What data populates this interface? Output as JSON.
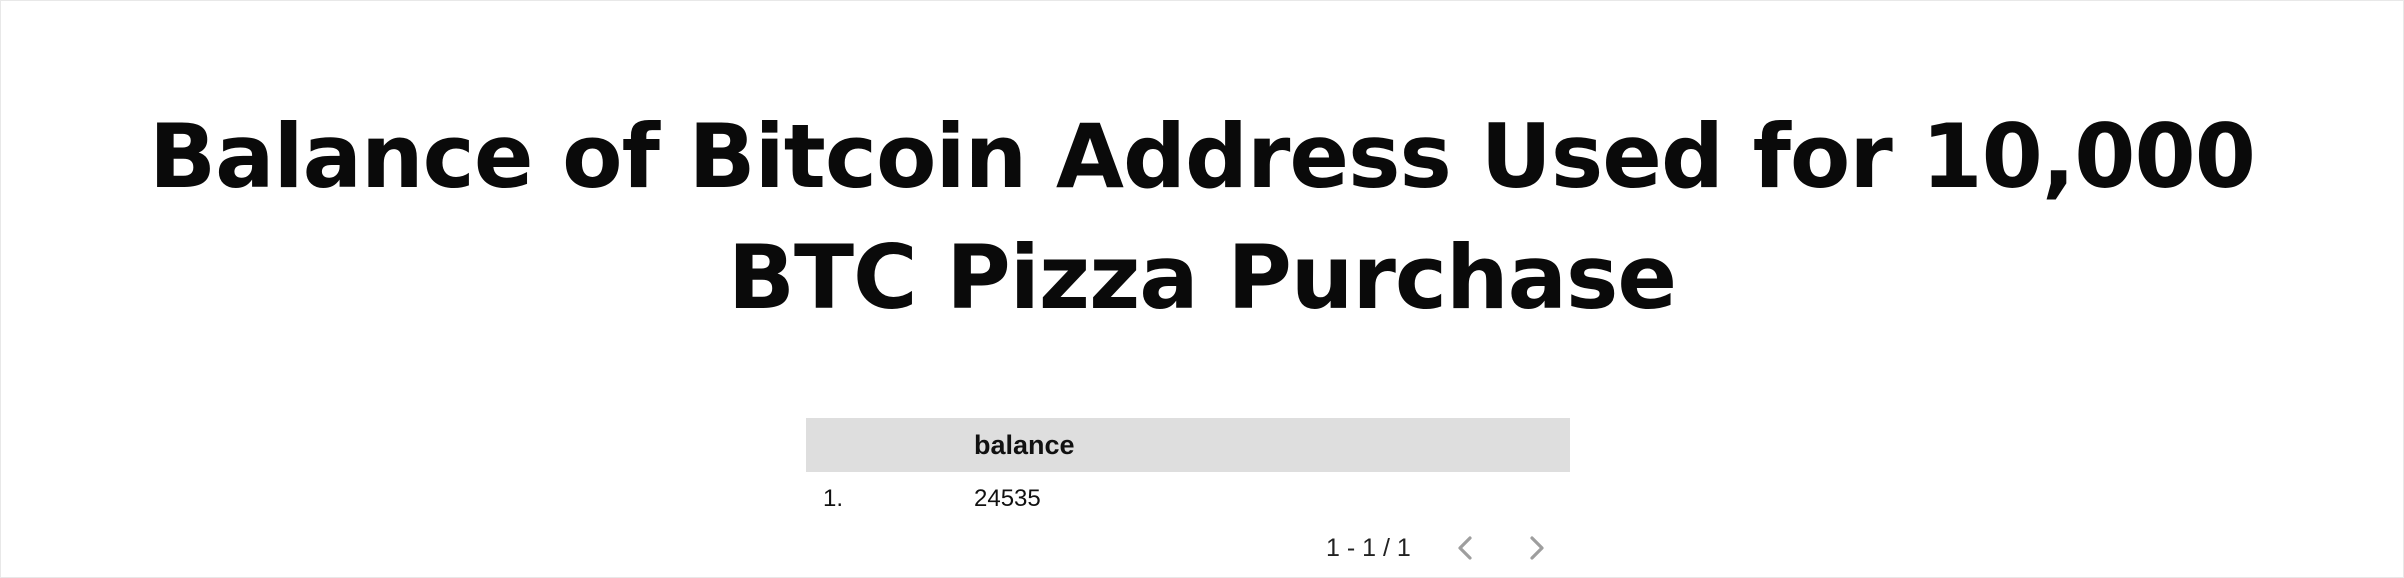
{
  "report": {
    "title": "Balance of Bitcoin Address Used for 10,000 BTC Pizza Purchase"
  },
  "table": {
    "columns": [
      "",
      "balance"
    ],
    "rows": [
      {
        "index": "1.",
        "balance": "24535"
      }
    ]
  },
  "pagination": {
    "label": "1 - 1 / 1",
    "prev_icon": "chevron-left-icon",
    "next_icon": "chevron-right-icon"
  },
  "colors": {
    "header_bg": "#dedede",
    "text": "#111111",
    "nav_icon": "#9e9e9e"
  }
}
